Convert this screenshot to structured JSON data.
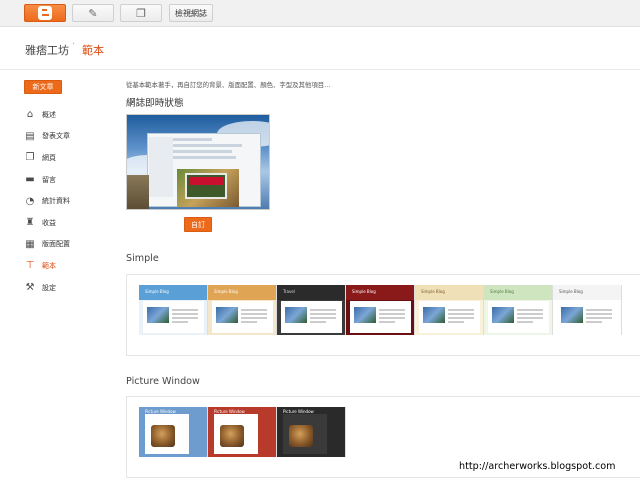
{
  "toolbar": {
    "logo_icon": "blogger-logo-icon",
    "pencil_icon": "pencil-icon",
    "pages_icon": "copy-pages-icon",
    "view_blog_label": "檢視網誌"
  },
  "header": {
    "blog_name": "雅痞工坊",
    "separator": "·",
    "page_name": "範本"
  },
  "sidebar": {
    "new_post_label": "新文章",
    "items": [
      {
        "label": "概述",
        "icon": "home-icon",
        "active": false
      },
      {
        "label": "發表文章",
        "icon": "posts-icon",
        "active": false
      },
      {
        "label": "網頁",
        "icon": "pages-icon",
        "active": false
      },
      {
        "label": "留言",
        "icon": "comments-icon",
        "active": false
      },
      {
        "label": "統計資料",
        "icon": "stats-pie-icon",
        "active": false
      },
      {
        "label": "收益",
        "icon": "trophy-icon",
        "active": false
      },
      {
        "label": "版面配置",
        "icon": "layout-icon",
        "active": false
      },
      {
        "label": "範本",
        "icon": "template-brush-icon",
        "active": true
      },
      {
        "label": "設定",
        "icon": "wrench-icon",
        "active": false
      }
    ]
  },
  "main": {
    "intro": "從基本範本著手，再自訂您的背景、版面配置、顏色、字型及其他項目…",
    "live_heading": "網誌即時狀態",
    "customize_label": "自訂",
    "sections": [
      {
        "title": "Simple",
        "thumbs": [
          {
            "title": "Simple Blog",
            "head_color": "#5aa0d6",
            "title_color": "#ffffff",
            "bg": "#e9f2f9"
          },
          {
            "title": "Simple Blog",
            "head_color": "#e0a455",
            "title_color": "#ffffff",
            "bg": "#f4e6c8"
          },
          {
            "title": "Travel",
            "head_color": "#2b2b2b",
            "title_color": "#dddddd",
            "bg": "#3a3a3a"
          },
          {
            "title": "Simple Blog",
            "head_color": "#8a1a1a",
            "title_color": "#ffffff",
            "bg": "#6a1010"
          },
          {
            "title": "Simple Blog",
            "head_color": "#f0e0b8",
            "title_color": "#7a5a2a",
            "bg": "#faf1da"
          },
          {
            "title": "Simple Blog",
            "head_color": "#cfe5c0",
            "title_color": "#4a7a3a",
            "bg": "#eef6e8"
          },
          {
            "title": "Simple Blog",
            "head_color": "#f4f4f4",
            "title_color": "#555555",
            "bg": "#ffffff"
          }
        ]
      },
      {
        "title": "Picture Window",
        "thumbs": [
          {
            "title": "Picture Window",
            "bg": "#6f9ccf"
          },
          {
            "title": "Picture Window",
            "bg": "#b83a2a"
          },
          {
            "title": "Picture Window",
            "bg": "#2a2a2a"
          }
        ]
      }
    ]
  },
  "watermark": "http://archerworks.blogspot.com",
  "colors": {
    "accent": "#ee6a1b",
    "active_text": "#dd4b12"
  }
}
